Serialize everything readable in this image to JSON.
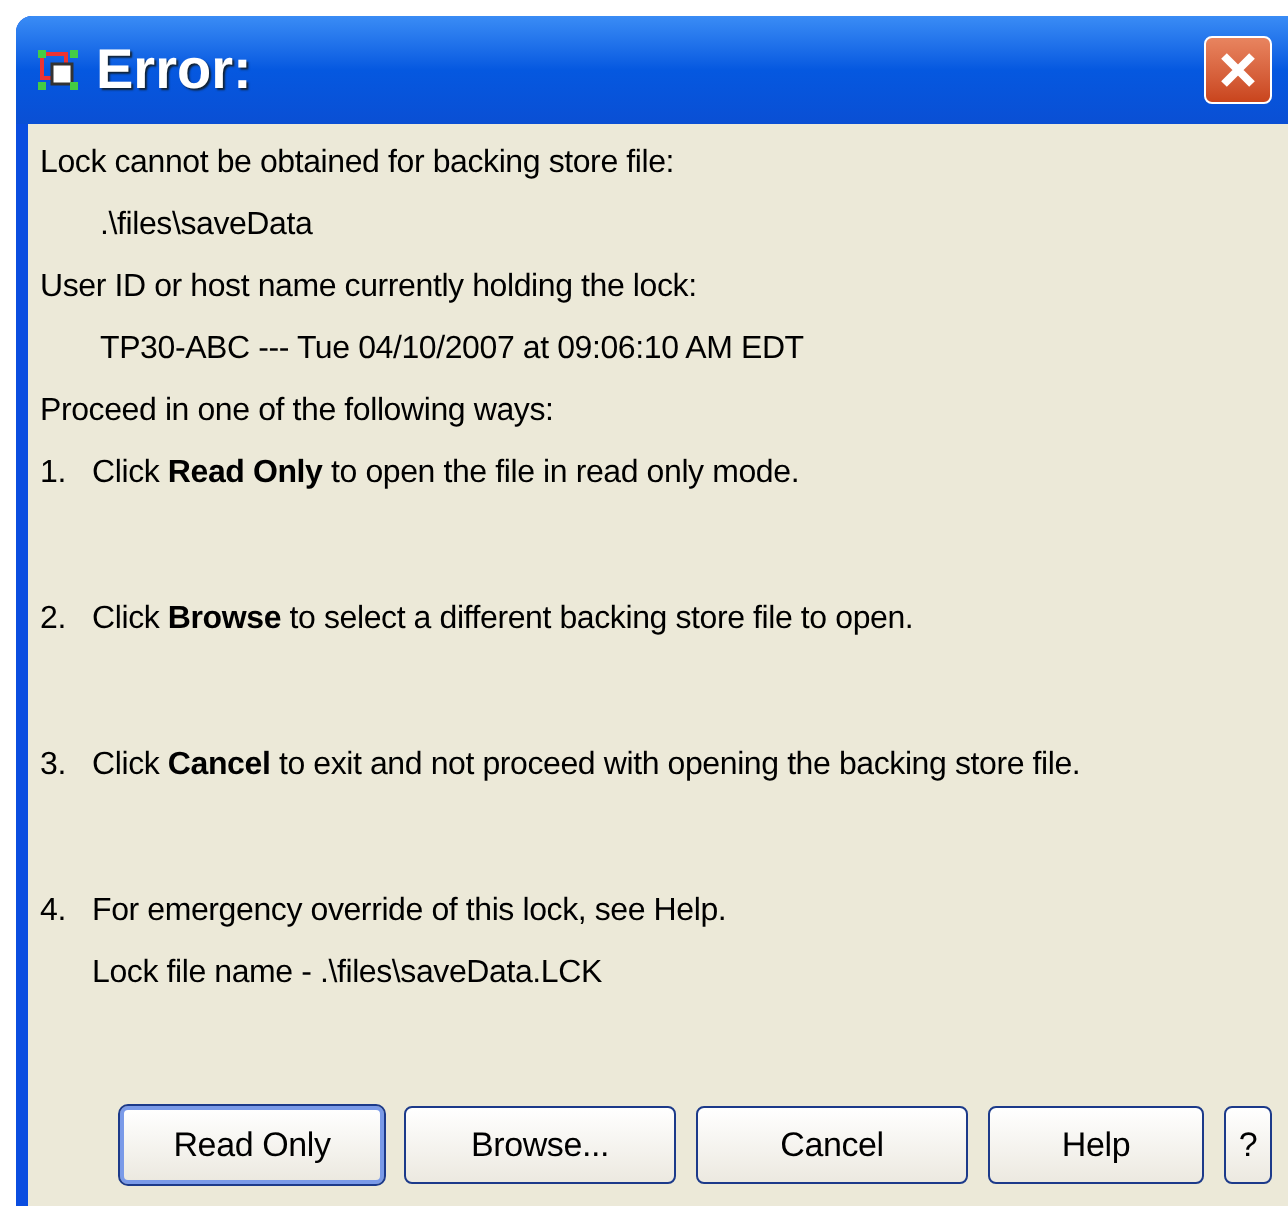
{
  "window": {
    "title": "Error:"
  },
  "lines": [
    {
      "kind": "plain",
      "text": "Lock cannot be obtained for backing store file:"
    },
    {
      "kind": "indented",
      "text": ".\\files\\saveData"
    },
    {
      "kind": "plain",
      "text": "User ID or host name currently holding the lock:"
    },
    {
      "kind": "indented",
      "text": "TP30-ABC --- Tue 04/10/2007 at 09:06:10 AM EDT"
    },
    {
      "kind": "plain",
      "text": "Proceed in one of the following ways:"
    },
    {
      "kind": "step",
      "number": "1.",
      "text": "Click **Read Only** to open the file in read only mode."
    },
    {
      "kind": "step",
      "number": "2.",
      "text": "Click **Browse** to select a different backing store file to open."
    },
    {
      "kind": "step",
      "number": "3.",
      "text": "Click **Cancel** to exit and not proceed with opening the backing store file."
    },
    {
      "kind": "step",
      "number": "4.",
      "text": "For emergency override of this lock, see Help."
    },
    {
      "kind": "continuation",
      "text": "Lock file name - .\\files\\saveData.LCK"
    }
  ],
  "buttons": [
    {
      "label": "Read Only",
      "default": true
    },
    {
      "label": "Browse...",
      "default": false
    },
    {
      "label": "Cancel",
      "default": false
    },
    {
      "label": "Help",
      "default": false
    },
    {
      "label": "?",
      "default": false
    }
  ]
}
